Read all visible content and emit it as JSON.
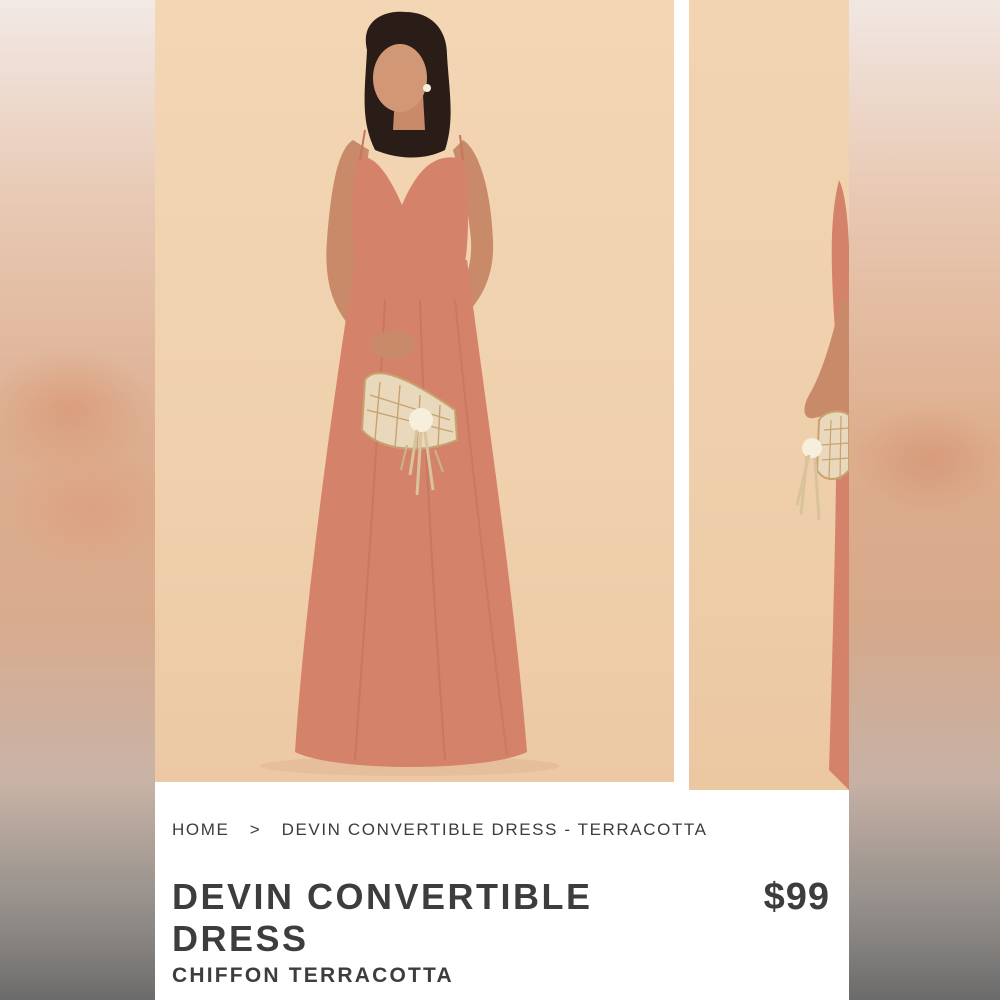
{
  "breadcrumb": {
    "home": "HOME",
    "separator": ">",
    "current": "DEVIN CONVERTIBLE DRESS - TERRACOTTA"
  },
  "product": {
    "title": "DEVIN CONVERTIBLE DRESS",
    "price": "$99",
    "variant": "CHIFFON TERRACOTTA"
  },
  "gallery": {
    "main_image": "model-front-image",
    "second_image": "model-side-image"
  },
  "colors": {
    "backdrop": "#f1d2b0",
    "dress": "#d5826a",
    "text": "#3d3d3d"
  }
}
